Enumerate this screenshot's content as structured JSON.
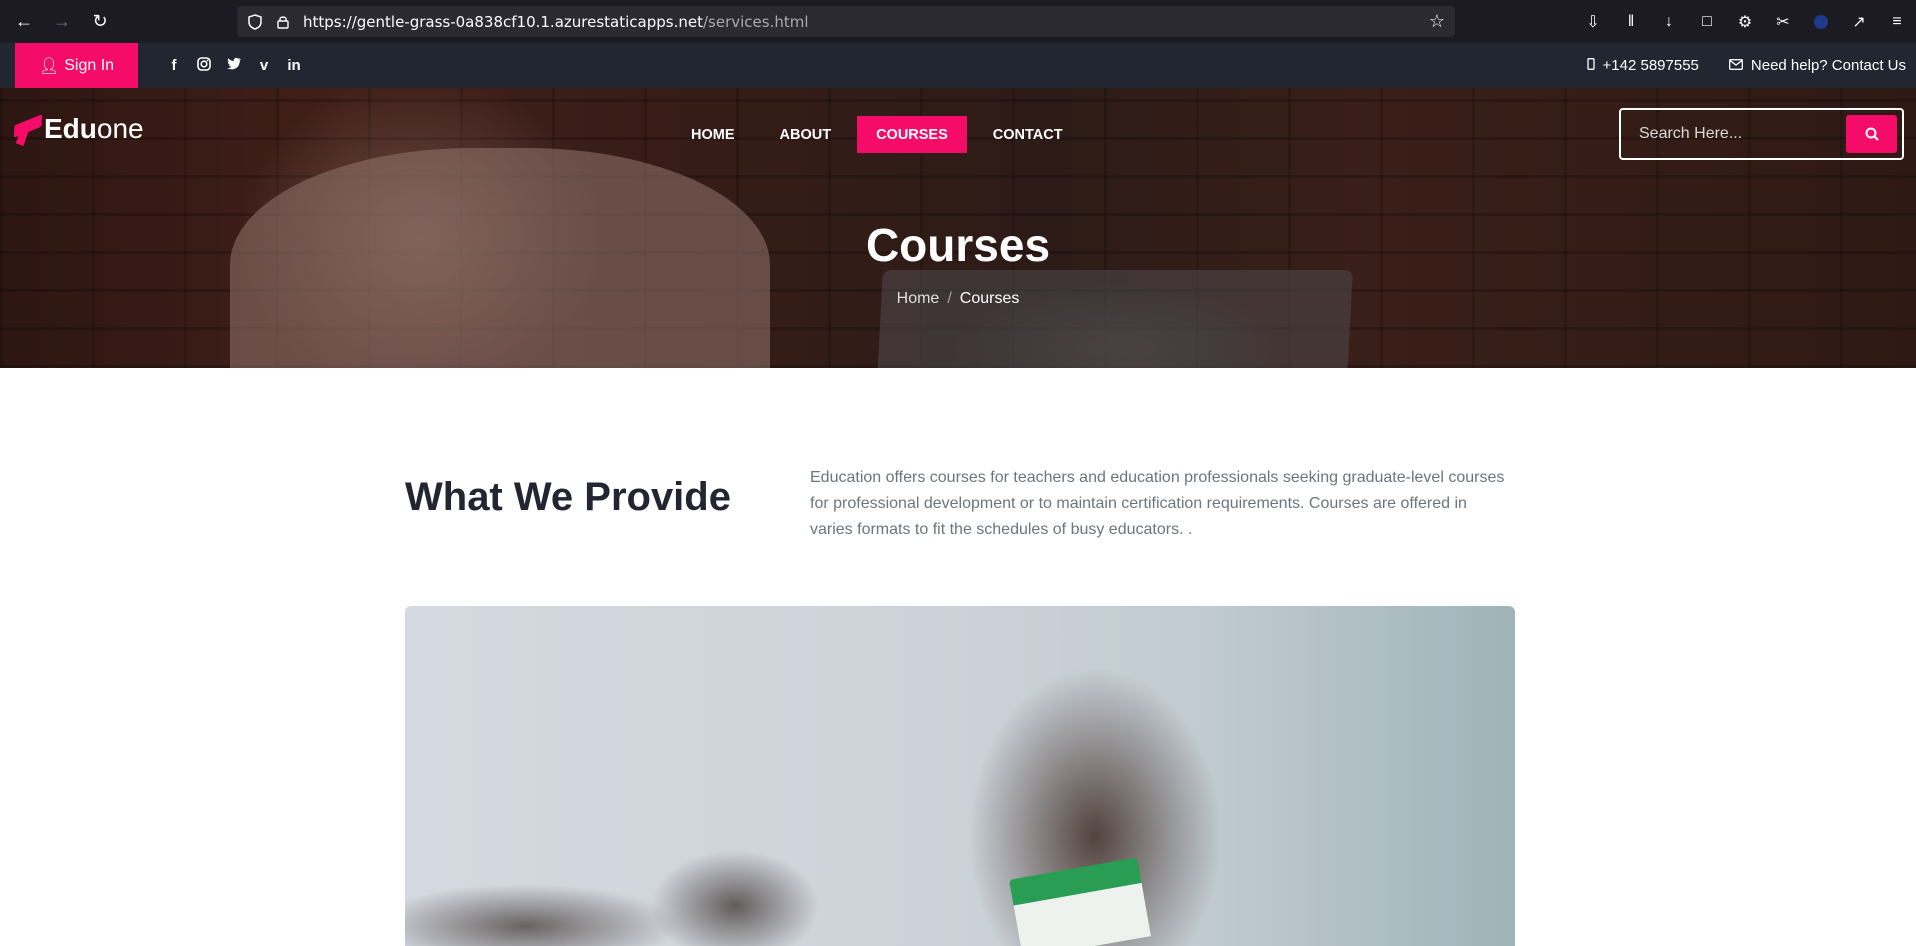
{
  "browser": {
    "url_host": "https://gentle-grass-0a838cf10.1.azurestaticapps.net",
    "url_path": "/services.html"
  },
  "topbar": {
    "signin_label": "Sign In",
    "phone": "+142 5897555",
    "help": "Need help? Contact Us",
    "social_icons": [
      "facebook-icon",
      "instagram-icon",
      "twitter-icon",
      "vimeo-icon",
      "linkedin-icon"
    ]
  },
  "brand": {
    "bold": "Edu",
    "light": "one"
  },
  "nav": {
    "items": [
      {
        "label": "HOME"
      },
      {
        "label": "ABOUT"
      },
      {
        "label": "COURSES",
        "active": true
      },
      {
        "label": "CONTACT"
      }
    ]
  },
  "search": {
    "placeholder": "Search Here..."
  },
  "hero": {
    "title": "Courses",
    "breadcrumb_home": "Home",
    "breadcrumb_sep": "/",
    "breadcrumb_current": "Courses"
  },
  "provide": {
    "title": "What We Provide",
    "text": "Education offers courses for teachers and education professionals seeking graduate-level courses for professional development or to maintain certification requirements. Courses are offered in varies formats to fit the schedules of busy educators. ."
  },
  "colors": {
    "accent": "#f50c69",
    "dark": "#212631",
    "muted": "#6c757d"
  }
}
